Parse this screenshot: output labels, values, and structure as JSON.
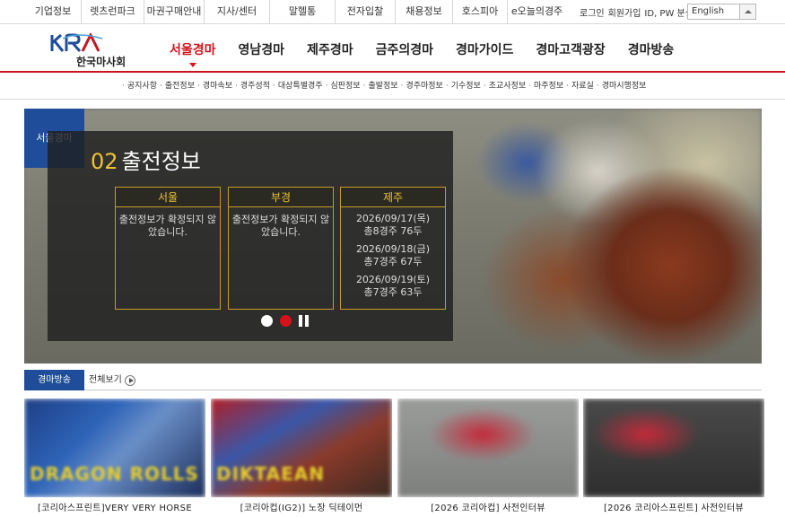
{
  "util_menu": [
    "기업정보",
    "렛츠런파크",
    "마권구매안내",
    "지사/센터",
    "말헬통",
    "전자입찰",
    "채용정보",
    "호스피아",
    "e오늘의경주"
  ],
  "util_right": {
    "login": "로그인",
    "join": "회원가입",
    "find": "ID, PW 분실"
  },
  "language": {
    "selected": "English"
  },
  "logo": {
    "name": "한국마사회"
  },
  "gnb": [
    "서울경마",
    "영남경마",
    "제주경마",
    "금주의경마",
    "경마가이드",
    "경마고객광장",
    "경마방송"
  ],
  "sub_menu": [
    "공지사항",
    "출전정보",
    "경마속보",
    "경주성적",
    "대상특별경주",
    "심판정보",
    "출발정보",
    "경주마정보",
    "기수정보",
    "조교사정보",
    "마주정보",
    "자료실",
    "경마시행정보"
  ],
  "hero": {
    "tab": "서울경마",
    "number": "02",
    "title": "출전정보",
    "boxes": [
      {
        "header": "서울",
        "text": "출전정보가 확정되지 않았습니다."
      },
      {
        "header": "부경",
        "text": "출전정보가 확정되지 않았습니다."
      },
      {
        "header": "제주",
        "schedule": [
          {
            "date": "2026/09/17(목)",
            "info": "총8경주 76두"
          },
          {
            "date": "2026/09/18(금)",
            "info": "총7경주 67두"
          },
          {
            "date": "2026/09/19(토)",
            "info": "총7경주 63두"
          }
        ]
      }
    ]
  },
  "broadcast": {
    "tab": "경마방송",
    "view_all": "전체보기",
    "videos": [
      {
        "label": "[코리아스프린트]VERY VERY HORSE",
        "caption": "DRAGON ROLLS"
      },
      {
        "label": "[코리아컵(IG2)] 노장 딕테이먼",
        "caption": "DIKTAEAN"
      },
      {
        "label": "[2026 코리아컵] 사전인터뷰",
        "caption": ""
      },
      {
        "label": "[2026 코리아스프린트] 사전인터뷰",
        "caption": ""
      }
    ]
  },
  "colors": {
    "brand_red": "#d6111b",
    "brand_blue": "#1f4d9a",
    "gold": "#f0c234"
  }
}
